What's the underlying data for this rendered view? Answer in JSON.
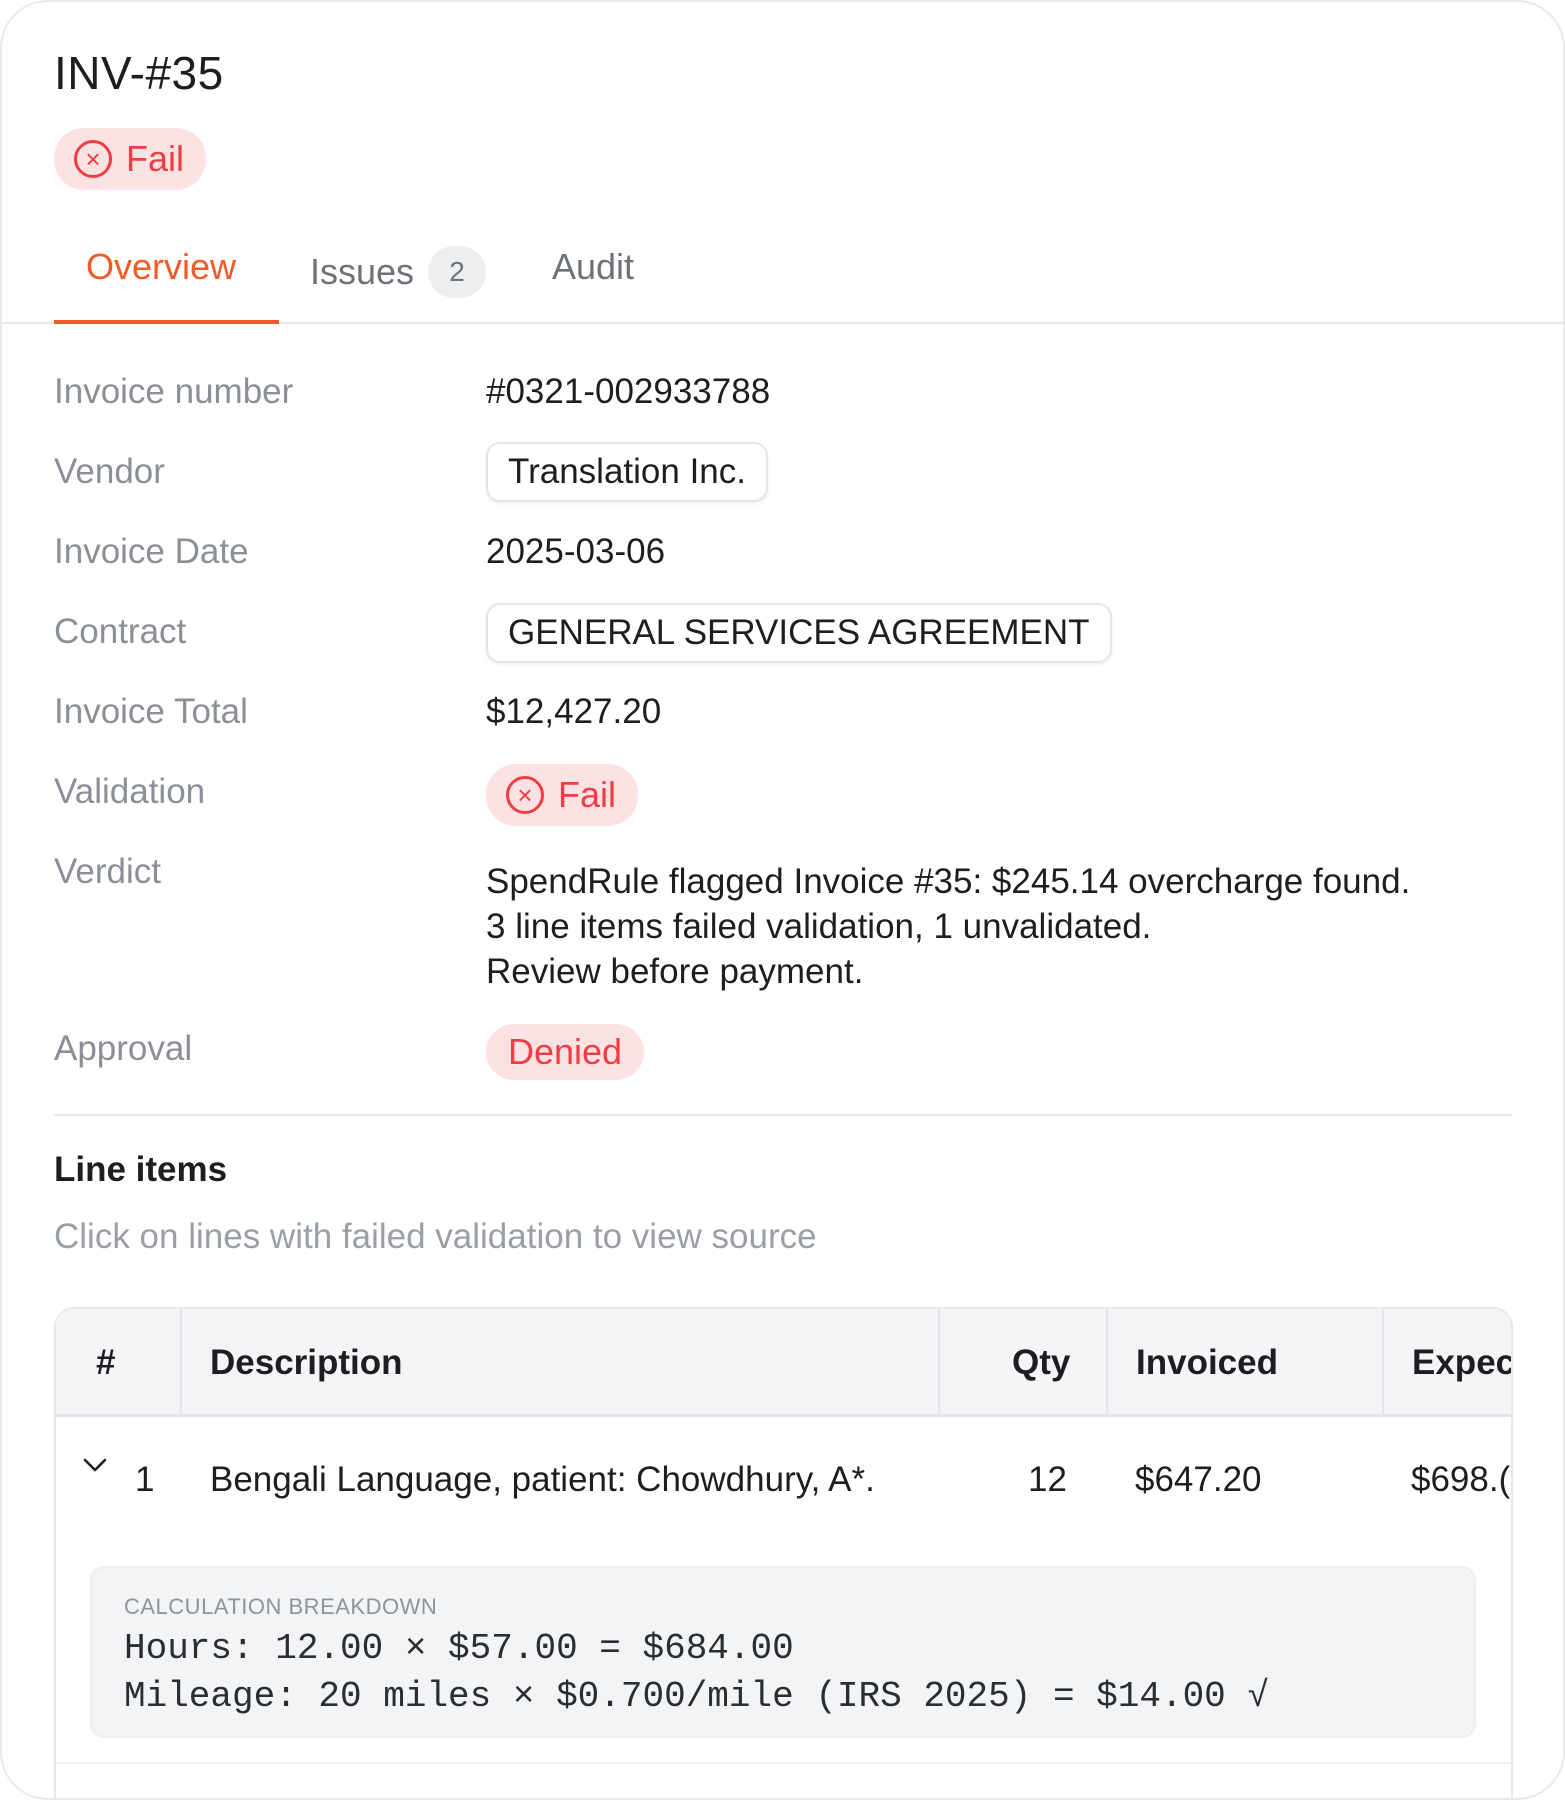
{
  "header": {
    "title": "INV-#35",
    "status_badge": "Fail"
  },
  "tabs": [
    {
      "label": "Overview",
      "active": true
    },
    {
      "label": "Issues",
      "count": "2"
    },
    {
      "label": "Audit"
    }
  ],
  "details": {
    "invoice_number": {
      "label": "Invoice number",
      "value": "#0321-002933788"
    },
    "vendor": {
      "label": "Vendor",
      "value": "Translation Inc."
    },
    "invoice_date": {
      "label": "Invoice Date",
      "value": "2025-03-06"
    },
    "contract": {
      "label": "Contract",
      "value": "GENERAL SERVICES AGREEMENT"
    },
    "invoice_total": {
      "label": "Invoice Total",
      "value": "$12,427.20"
    },
    "validation": {
      "label": "Validation",
      "value": "Fail"
    },
    "verdict": {
      "label": "Verdict",
      "lines": [
        "SpendRule flagged Invoice #35: $245.14 overcharge found.",
        "3 line items failed validation, 1 unvalidated.",
        "Review before payment."
      ]
    },
    "approval": {
      "label": "Approval",
      "value": "Denied"
    }
  },
  "line_items": {
    "title": "Line items",
    "subtitle": "Click on lines with failed validation to view source",
    "columns": [
      "#",
      "Description",
      "Qty",
      "Invoiced",
      "Expec"
    ],
    "rows": [
      {
        "num": "1",
        "description": "Bengali Language, patient: Chowdhury, A*.",
        "qty": "12",
        "invoiced": "$647.20",
        "expected": "$698.("
      }
    ],
    "calculation": {
      "title": "CALCULATION BREAKDOWN",
      "lines": [
        "Hours: 12.00 × $57.00 = $684.00",
        "Mileage: 20 miles × $0.700/mile (IRS 2025) = $14.00 √"
      ]
    }
  },
  "colors": {
    "accent": "#f25a28",
    "fail": "#ef3e43",
    "fail_bg": "#fde2e3"
  },
  "icons": {
    "status": "x-circle-icon",
    "expand": "chevron-down-icon"
  }
}
